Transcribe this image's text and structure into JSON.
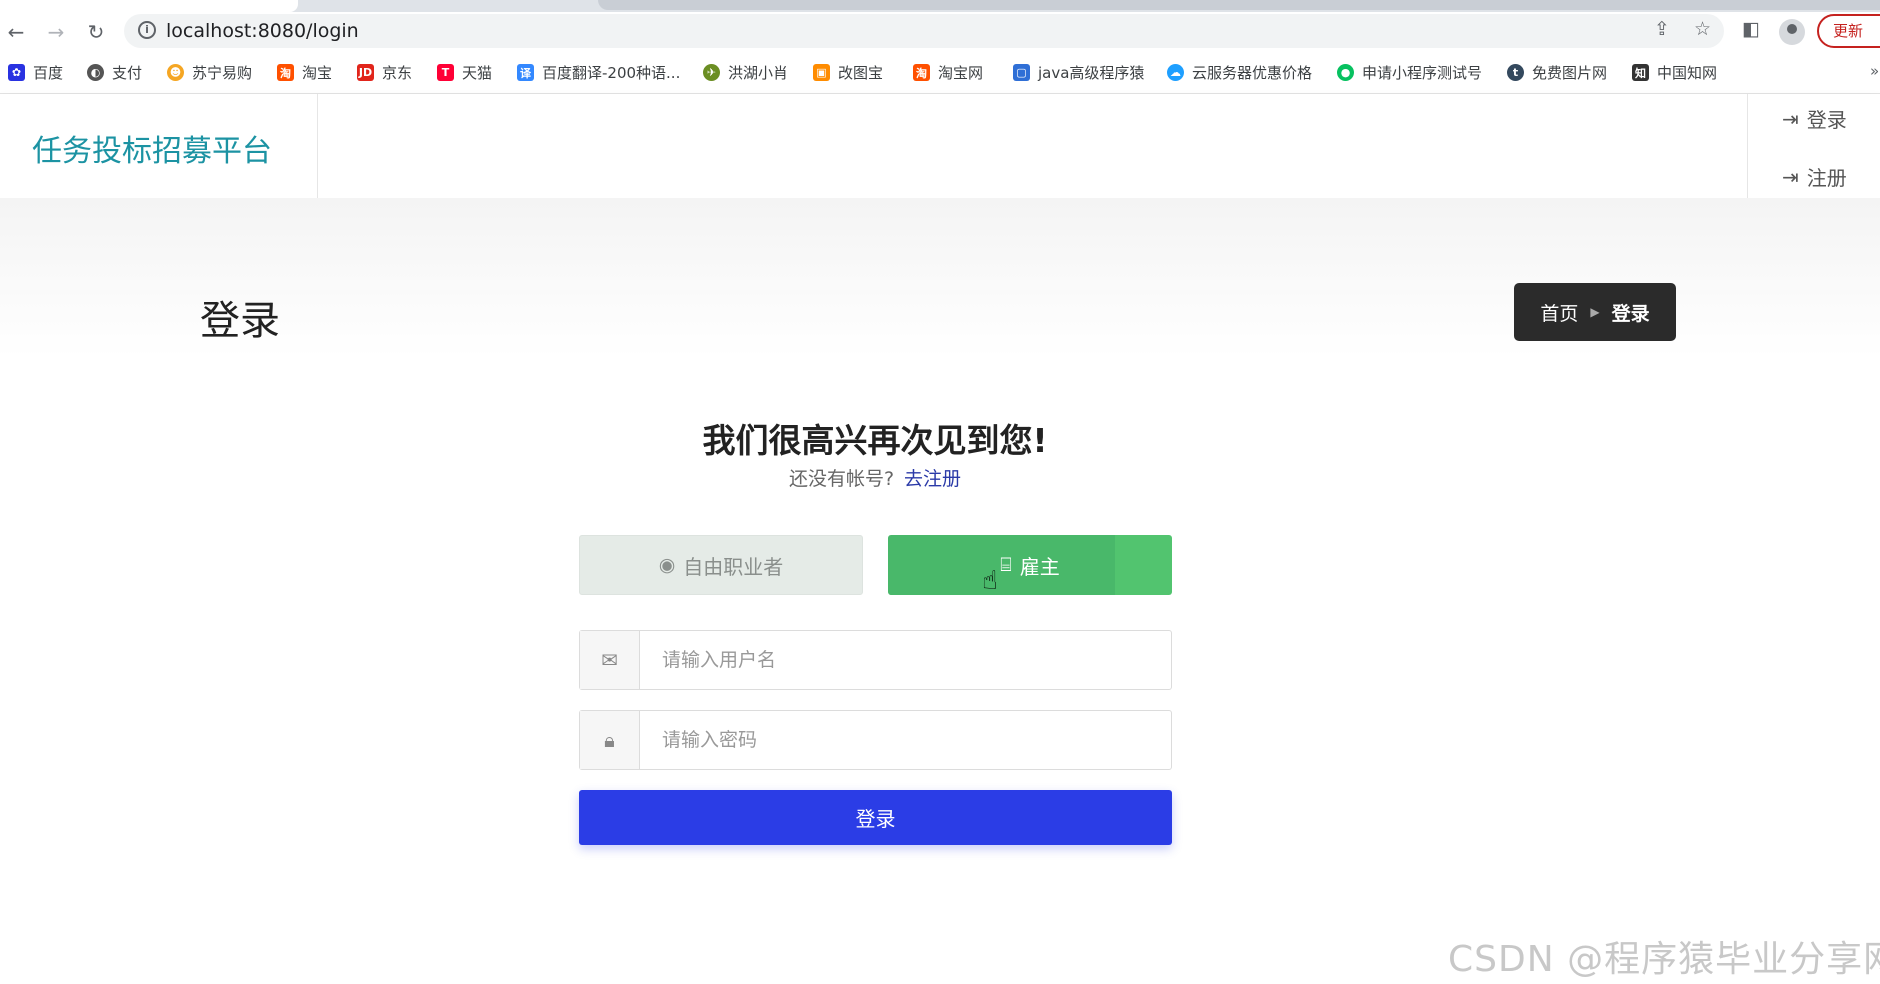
{
  "browser": {
    "url": "localhost:8080/login",
    "update_label": "更新",
    "bookmarks": [
      {
        "label": "百度",
        "color": "#2932e1"
      },
      {
        "label": "支付",
        "color": "#555555"
      },
      {
        "label": "苏宁易购",
        "color": "#f5a623"
      },
      {
        "label": "淘宝",
        "color": "#ff5000"
      },
      {
        "label": "京东",
        "color": "#e1251b"
      },
      {
        "label": "天猫",
        "color": "#ff0036"
      },
      {
        "label": "百度翻译-200种语...",
        "color": "#3388ff"
      },
      {
        "label": "洪湖小肖",
        "color": "#6b8e23"
      },
      {
        "label": "改图宝",
        "color": "#ff8c00"
      },
      {
        "label": "淘宝网",
        "color": "#ff5000"
      },
      {
        "label": "java高级程序猿",
        "color": "#2f6fd6"
      },
      {
        "label": "云服务器优惠价格",
        "color": "#1e9fff"
      },
      {
        "label": "申请小程序测试号",
        "color": "#07c160"
      },
      {
        "label": "免费图片网",
        "color": "#34495e"
      },
      {
        "label": "中国知网",
        "color": "#333333"
      }
    ],
    "bookmarks_more": "»"
  },
  "header": {
    "brand": "任务投标招募平台",
    "login_link": "登录",
    "register_link": "注册"
  },
  "page": {
    "title": "登录",
    "breadcrumb": {
      "home": "首页",
      "current": "登录"
    }
  },
  "form": {
    "welcome": "我们很高兴再次见到您!",
    "no_account": "还没有帐号?",
    "go_register": "去注册",
    "role_freelancer": "自由职业者",
    "role_employer": "雇主",
    "username_placeholder": "请输入用户名",
    "password_placeholder": "请输入密码",
    "submit": "登录"
  },
  "watermark": "CSDN @程序猿毕业分享网"
}
